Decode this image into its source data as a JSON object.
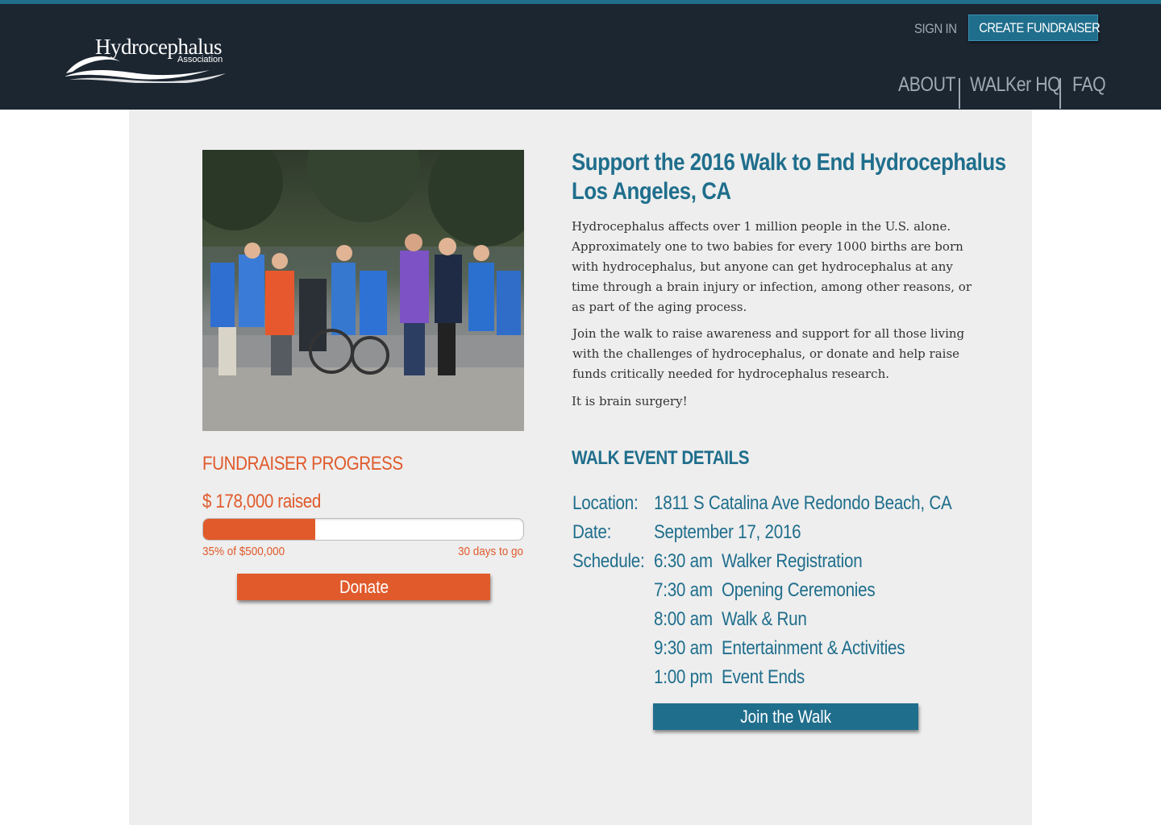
{
  "header": {
    "logo": {
      "name": "Hydrocephalus",
      "subtitle": "Association"
    },
    "sign_in": "SIGN IN",
    "create_fundraiser": "CREATE FUNDRAISER",
    "nav": {
      "about": "ABOUT",
      "walker_hq": "WALKer HQ",
      "faq": "FAQ"
    }
  },
  "colors": {
    "header_bg": "#1c2631",
    "accent_blue": "#1f6e8c",
    "accent_orange": "#e05a2b",
    "panel_bg": "#eeeeee"
  },
  "hero_image": {
    "alt": "Photo of walkers at a hydrocephalus walk event"
  },
  "progress": {
    "title": "FUNDRAISER PROGRESS",
    "raised": "$ 178,000 raised",
    "percent": 35,
    "goal_text": "35% of $500,000",
    "days_left": "30 days to go",
    "donate_label": "Donate"
  },
  "campaign": {
    "title_line1": "Support the 2016 Walk to End Hydrocephalus",
    "title_line2": "Los Angeles, CA",
    "paragraph1": "Hydrocephalus affects over 1 million people in the U.S. alone. Approximately one to two babies for every 1000 births are born with hydrocephalus, but anyone can get hydrocephalus at any time through a brain injury or infection, among other reasons, or as part of the aging process.",
    "paragraph2": "Join the walk to raise awareness and support for all those living with the challenges of hydrocephalus, or donate and help raise funds critically needed for hydrocephalus research.",
    "paragraph3": "It is brain surgery!"
  },
  "event": {
    "title": "WALK EVENT DETAILS",
    "location_label": "Location:",
    "location": "1811 S Catalina Ave Redondo Beach, CA",
    "date_label": "Date:",
    "date": "September 17, 2016",
    "schedule_label": "Schedule:",
    "schedule": [
      {
        "time": "6:30 am",
        "activity": "Walker Registration"
      },
      {
        "time": "7:30 am",
        "activity": "Opening Ceremonies"
      },
      {
        "time": "8:00 am",
        "activity": "Walk & Run"
      },
      {
        "time": "9:30 am",
        "activity": "Entertainment & Activities"
      },
      {
        "time": "1:00 pm",
        "activity": "Event Ends"
      }
    ],
    "join_label": "Join the Walk"
  }
}
